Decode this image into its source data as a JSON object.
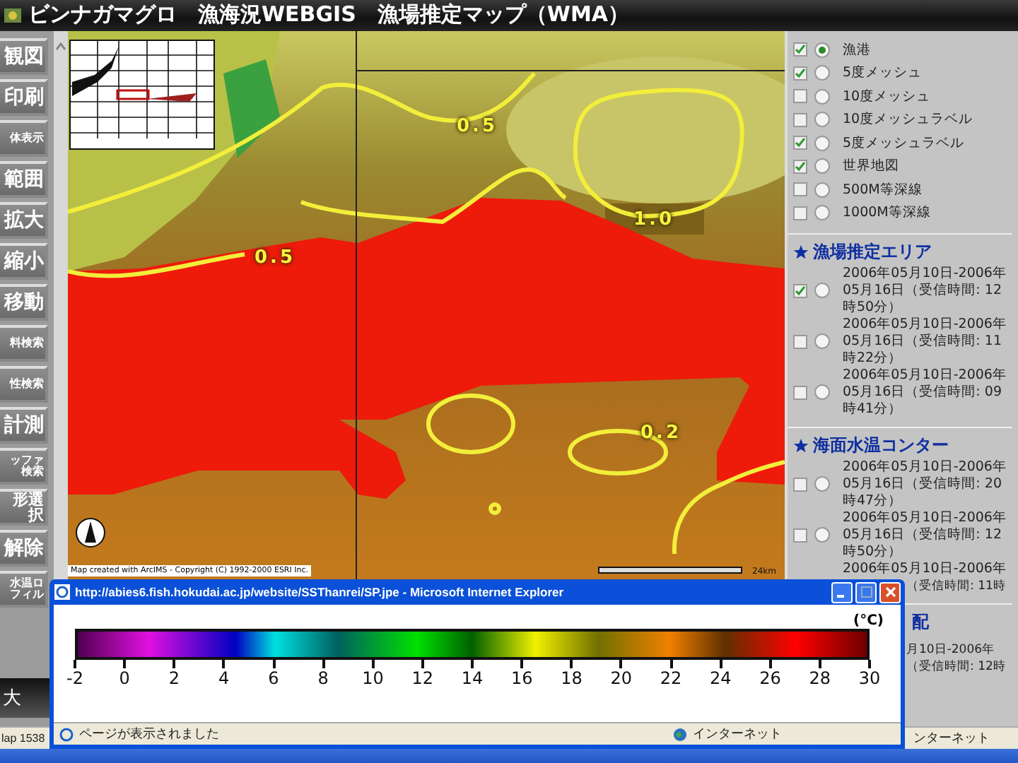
{
  "window": {
    "title": "ビンナガマグロ　漁海況WEBGIS　漁場推定マップ（WMA）"
  },
  "tools": [
    {
      "label": "観図",
      "kind": "large"
    },
    {
      "label": "印刷",
      "kind": "large"
    },
    {
      "label": "体表示",
      "kind": "small"
    },
    {
      "label": "範囲",
      "kind": "large"
    },
    {
      "label": "拡大",
      "kind": "large"
    },
    {
      "label": "縮小",
      "kind": "large"
    },
    {
      "label": "移動",
      "kind": "large"
    },
    {
      "label": "料検索",
      "kind": "small"
    },
    {
      "label": "性検索",
      "kind": "small"
    },
    {
      "label": "計測",
      "kind": "large"
    },
    {
      "label": "ッファ検索",
      "kind": "small"
    },
    {
      "label": "形選択",
      "kind": "medium"
    },
    {
      "label": "解除",
      "kind": "large"
    },
    {
      "label": "水温ロフィル",
      "kind": "small"
    }
  ],
  "tool_footer": "大",
  "map": {
    "contour_labels": [
      "0.5",
      "1.0",
      "0.5",
      "0.2"
    ],
    "copyright": "Map created with ArcIMS - Copyright (C) 1992-2000 ESRI Inc.",
    "scale_label": "24km"
  },
  "layers": [
    {
      "name": "漁港",
      "checked": true,
      "selected": true
    },
    {
      "name": "5度メッシュ",
      "checked": true,
      "selected": false
    },
    {
      "name": "10度メッシュ",
      "checked": false,
      "selected": false
    },
    {
      "name": "10度メッシュラベル",
      "checked": false,
      "selected": false
    },
    {
      "name": "5度メッシュラベル",
      "checked": true,
      "selected": false
    },
    {
      "name": "世界地図",
      "checked": true,
      "selected": false
    },
    {
      "name": "500M等深線",
      "checked": false,
      "selected": false
    },
    {
      "name": "1000M等深線",
      "checked": false,
      "selected": false
    }
  ],
  "sections": [
    {
      "title": {
        "text": "漁場推定エリア",
        "clipped": false
      },
      "items": [
        {
          "kind": "entry",
          "checked": true,
          "selected": false,
          "text": "2006年05月10日-2006年05月16日（受信時間: 12時50分）"
        },
        {
          "kind": "entry",
          "checked": false,
          "selected": false,
          "text": "2006年05月10日-2006年05月16日（受信時間: 11時22分）"
        },
        {
          "kind": "entry",
          "checked": false,
          "selected": false,
          "text": "2006年05月10日-2006年05月16日（受信時間: 09時41分）"
        }
      ]
    },
    {
      "title": {
        "text": "海面水温コンター",
        "clipped": false
      },
      "items": [
        {
          "kind": "entry",
          "checked": false,
          "selected": false,
          "text": "2006年05月10日-2006年05月16日（受信時間: 20時47分）"
        },
        {
          "kind": "entry",
          "checked": false,
          "selected": false,
          "text": "2006年05月10日-2006年05月16日（受信時間: 12時50分）"
        },
        {
          "kind": "fragment",
          "lines": [
            {
              "text": "2006年05月10日-2006年",
              "clipped": false
            },
            {
              "text": "（受信時間: 11時",
              "clipped": true
            }
          ]
        }
      ]
    },
    {
      "title": {
        "text": "配",
        "clipped": true
      },
      "items": [
        {
          "kind": "fragment",
          "lines": [
            {
              "text": "月10日-2006年",
              "clipped": true
            },
            {
              "text": "（受信時間: 12時",
              "clipped": true
            }
          ]
        }
      ]
    }
  ],
  "status_bar": {
    "left": "lap 1538",
    "right": "ンターネット"
  },
  "popup": {
    "title": "http://abies6.fish.hokudai.ac.jp/website/SSThanrei/SP.jpe - Microsoft Internet Explorer",
    "unit": "(°C)",
    "ticks": [
      "-2",
      "0",
      "2",
      "4",
      "6",
      "8",
      "10",
      "12",
      "14",
      "16",
      "18",
      "20",
      "22",
      "24",
      "26",
      "28",
      "30"
    ],
    "status": "ページが表示されました",
    "zone": "インターネット"
  }
}
